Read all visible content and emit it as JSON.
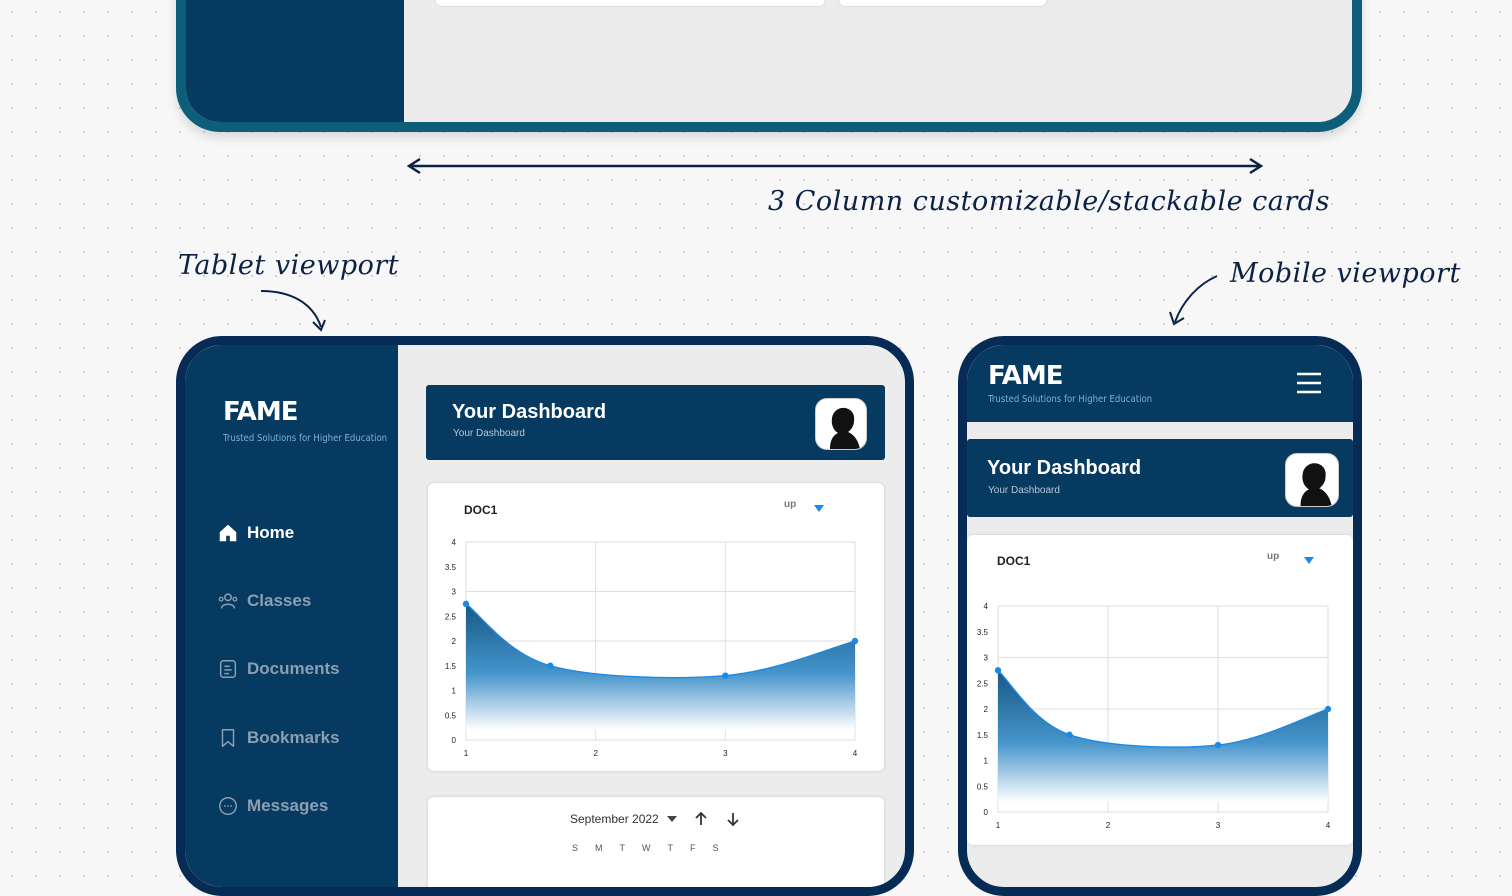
{
  "annotations": {
    "columns_note": "3 Column customizable/stackable cards",
    "tablet_label": "Tablet viewport",
    "mobile_label": "Mobile viewport"
  },
  "brand": {
    "logo": "FAME",
    "tagline": "Trusted Solutions for Higher Education"
  },
  "sidebar": {
    "items": [
      {
        "label": "Home",
        "icon": "home-icon",
        "active": true
      },
      {
        "label": "Classes",
        "icon": "users-icon",
        "active": false
      },
      {
        "label": "Documents",
        "icon": "document-icon",
        "active": false
      },
      {
        "label": "Bookmarks",
        "icon": "bookmark-icon",
        "active": false
      },
      {
        "label": "Messages",
        "icon": "message-icon",
        "active": false
      }
    ]
  },
  "dashboard": {
    "title": "Your Dashboard",
    "subtitle": "Your Dashboard"
  },
  "chart_card": {
    "title": "DOC1",
    "filter_label": "up"
  },
  "calendar": {
    "month": "September 2022",
    "weekdays": [
      "S",
      "M",
      "T",
      "W",
      "T",
      "F",
      "S"
    ]
  },
  "colors": {
    "navy": "#073a60",
    "frame": "#062c56",
    "accent": "#1e88e5"
  },
  "chart_data": [
    {
      "type": "area",
      "title": "DOC1",
      "x": [
        1,
        1.65,
        3,
        4
      ],
      "series": [
        {
          "values": [
            2.75,
            1.5,
            1.3,
            2.0
          ]
        }
      ],
      "x_ticks": [
        1,
        2,
        3,
        4
      ],
      "y_ticks": [
        0,
        0.5,
        1,
        1.5,
        2,
        2.5,
        3,
        3.5,
        4
      ],
      "xlim": [
        1,
        4
      ],
      "ylim": [
        0,
        4
      ],
      "grid": true
    },
    {
      "type": "area",
      "title": "DOC1",
      "x": [
        1,
        1.65,
        3,
        4
      ],
      "series": [
        {
          "values": [
            2.75,
            1.5,
            1.3,
            2.0
          ]
        }
      ],
      "x_ticks": [
        1,
        2,
        3,
        4
      ],
      "y_ticks": [
        0,
        0.5,
        1,
        1.5,
        2,
        2.5,
        3,
        3.5,
        4
      ],
      "xlim": [
        1,
        4
      ],
      "ylim": [
        0,
        4
      ],
      "grid": true
    }
  ]
}
